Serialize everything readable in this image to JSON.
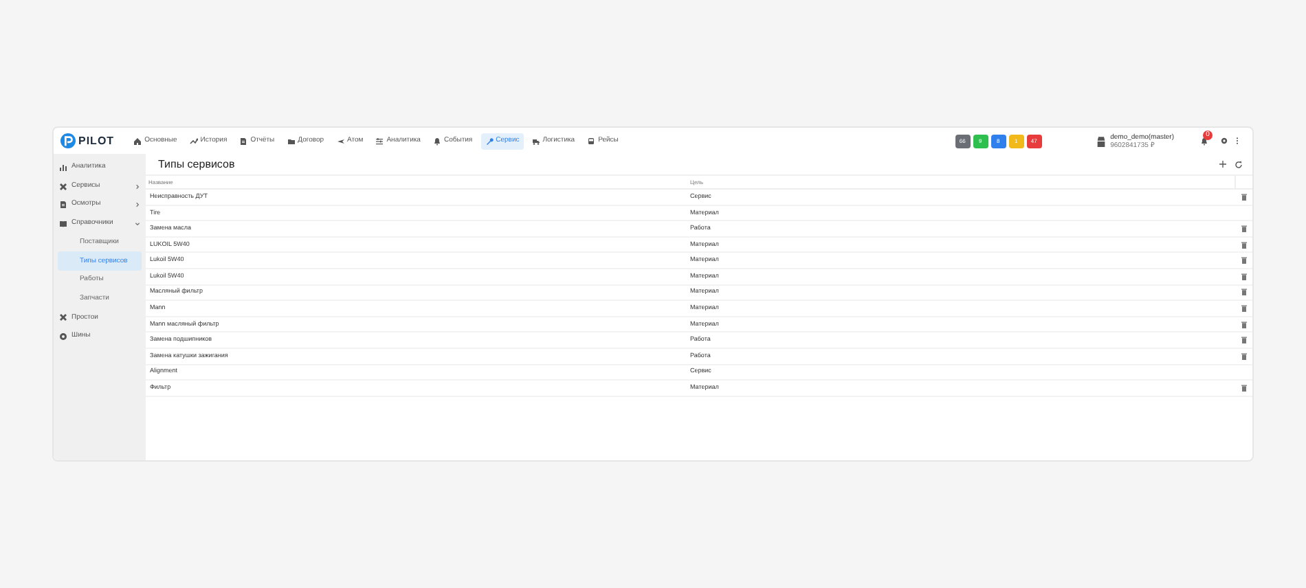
{
  "logo": "PILOT",
  "nav": [
    {
      "label": "Основные",
      "selected": false
    },
    {
      "label": "История",
      "selected": false
    },
    {
      "label": "Отчёты",
      "selected": false
    },
    {
      "label": "Договор",
      "selected": false
    },
    {
      "label": "Атом",
      "selected": false
    },
    {
      "label": "Аналитика",
      "selected": false
    },
    {
      "label": "События",
      "selected": false
    },
    {
      "label": "Сервис",
      "selected": true
    },
    {
      "label": "Логистика",
      "selected": false
    },
    {
      "label": "Рейсы",
      "selected": false
    }
  ],
  "counters": [
    {
      "text": "66",
      "color": "#6b6f75"
    },
    {
      "text": "9",
      "color": "#2fbf4f"
    },
    {
      "text": "8",
      "color": "#2f80ed"
    },
    {
      "text": "1",
      "color": "#f2b91a"
    },
    {
      "text": "47",
      "color": "#e83b3b"
    }
  ],
  "user": {
    "name": "demo_demo(master)",
    "balance": "9602841735 ₽"
  },
  "notifications": {
    "badge": "0"
  },
  "sidebar": {
    "items": [
      {
        "label": "Аналитика",
        "selected": false
      },
      {
        "label": "Сервисы",
        "selected": false,
        "expanded": false
      },
      {
        "label": "Осмотры",
        "selected": false,
        "expanded": false
      },
      {
        "label": "Справочники",
        "selected": false,
        "expanded": true,
        "children": [
          {
            "label": "Поставщики",
            "selected": false
          },
          {
            "label": "Типы сервисов",
            "selected": true
          },
          {
            "label": "Работы",
            "selected": false
          },
          {
            "label": "Запчасти",
            "selected": false
          }
        ]
      },
      {
        "label": "Простои",
        "selected": false
      },
      {
        "label": "Шины",
        "selected": false
      }
    ]
  },
  "page": {
    "title": "Типы сервисов"
  },
  "table": {
    "columns": [
      "Название",
      "Цель"
    ],
    "rows": [
      {
        "cells": [
          "Неисправность ДУТ",
          "Сервис"
        ],
        "deletable": true
      },
      {
        "cells": [
          "Tire",
          "Материал"
        ],
        "deletable": false
      },
      {
        "cells": [
          "Замена масла",
          "Работа"
        ],
        "deletable": true
      },
      {
        "cells": [
          "LUKOIL 5W40",
          "Материал"
        ],
        "deletable": true
      },
      {
        "cells": [
          "Lukoil 5W40",
          "Материал"
        ],
        "deletable": true
      },
      {
        "cells": [
          "Lukoil 5W40",
          "Материал"
        ],
        "deletable": true
      },
      {
        "cells": [
          "Масляный фильтр",
          "Материал"
        ],
        "deletable": true
      },
      {
        "cells": [
          "Mann",
          "Материал"
        ],
        "deletable": true
      },
      {
        "cells": [
          "Mann масляный фильтр",
          "Материал"
        ],
        "deletable": true
      },
      {
        "cells": [
          "Замена подшипников",
          "Работа"
        ],
        "deletable": true
      },
      {
        "cells": [
          "Замена катушки зажигания",
          "Работа"
        ],
        "deletable": true
      },
      {
        "cells": [
          "Alignment",
          "Сервис"
        ],
        "deletable": false
      },
      {
        "cells": [
          "Фильтр",
          "Материал"
        ],
        "deletable": true
      }
    ]
  }
}
